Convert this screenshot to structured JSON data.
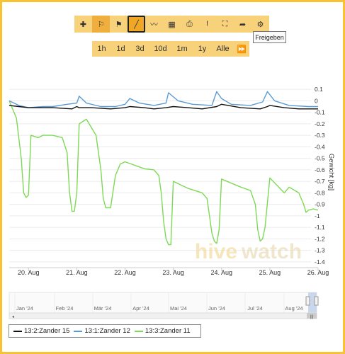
{
  "toolbar": {
    "buttons": [
      {
        "name": "add-icon",
        "glyph": "✚"
      },
      {
        "name": "flag-outline-icon",
        "glyph": "⚐"
      },
      {
        "name": "flag-icon",
        "glyph": "⚑"
      },
      {
        "name": "line-chart-icon",
        "glyph": "╱"
      },
      {
        "name": "annotate-chart-icon",
        "glyph": "〰"
      },
      {
        "name": "calendar-icon",
        "glyph": "▦"
      },
      {
        "name": "print-icon",
        "glyph": "⎙"
      },
      {
        "name": "alert-icon",
        "glyph": "!"
      },
      {
        "name": "fullscreen-icon",
        "glyph": "⛶"
      },
      {
        "name": "share-icon",
        "glyph": "➦"
      },
      {
        "name": "settings-icon",
        "glyph": "⚙"
      }
    ],
    "tooltip": "Freigeben"
  },
  "ranges": [
    "1h",
    "1d",
    "3d",
    "10d",
    "1m",
    "1y",
    "Alle"
  ],
  "ranges_forward_glyph": "⏩",
  "watermark": {
    "part1": "hive",
    "part2": "watch"
  },
  "colors": {
    "accent": "#f7c234",
    "series_black": "#111111",
    "series_blue": "#5b9bd5",
    "series_green": "#7ed957"
  },
  "chart_data": {
    "type": "line",
    "ylabel": "Gewicht [kg]",
    "ylim": [
      -1.45,
      0.15
    ],
    "yticks": [
      0.1,
      0,
      -0.1,
      -0.2,
      -0.3,
      -0.4,
      -0.5,
      -0.6,
      -0.7,
      -0.8,
      -0.9,
      -1,
      -1.1,
      -1.2,
      -1.3,
      -1.4
    ],
    "ytick_labels": [
      "0.1",
      "0",
      "-0.1",
      "-0.2",
      "-0.3",
      "-0.4",
      "-0.5",
      "-0.6",
      "-0.7",
      "-0.8",
      "-0.9",
      "-1",
      "-1.1",
      "-1.2",
      "-1.3",
      "-1.4"
    ],
    "xlim": [
      19.6,
      26.0
    ],
    "xticks": [
      20,
      21,
      22,
      23,
      24,
      25,
      26
    ],
    "xtick_labels": [
      "20. Aug",
      "21. Aug",
      "22. Aug",
      "23. Aug",
      "24. Aug",
      "25. Aug",
      "26. Aug"
    ],
    "series": [
      {
        "name": "13:2:Zander 15",
        "color": "#111111",
        "x": [
          19.6,
          19.8,
          20.0,
          20.5,
          20.9,
          21.0,
          21.05,
          21.3,
          21.7,
          22.0,
          22.1,
          22.4,
          22.6,
          22.85,
          23.0,
          23.3,
          23.6,
          23.9,
          24.0,
          24.4,
          24.8,
          24.95,
          25.0,
          25.3,
          25.6,
          26.0
        ],
        "y": [
          -0.04,
          -0.05,
          -0.06,
          -0.06,
          -0.07,
          -0.05,
          -0.06,
          -0.06,
          -0.07,
          -0.06,
          -0.05,
          -0.06,
          -0.07,
          -0.06,
          -0.05,
          -0.06,
          -0.07,
          -0.05,
          -0.03,
          -0.06,
          -0.07,
          -0.05,
          -0.04,
          -0.06,
          -0.07,
          -0.07
        ]
      },
      {
        "name": "13:1:Zander 12",
        "color": "#5b9bd5",
        "x": [
          19.6,
          19.8,
          20.0,
          20.3,
          20.5,
          20.8,
          21.0,
          21.05,
          21.2,
          21.5,
          21.8,
          22.0,
          22.1,
          22.3,
          22.6,
          22.85,
          22.9,
          23.1,
          23.4,
          23.8,
          23.9,
          24.0,
          24.2,
          24.6,
          24.85,
          24.95,
          25.1,
          25.4,
          25.8,
          26.0
        ],
        "y": [
          0.0,
          -0.04,
          -0.06,
          -0.05,
          -0.05,
          -0.03,
          -0.02,
          0.04,
          -0.02,
          -0.05,
          -0.05,
          -0.03,
          0.02,
          -0.02,
          -0.04,
          -0.02,
          0.07,
          0.0,
          -0.03,
          -0.04,
          0.08,
          0.02,
          -0.03,
          -0.04,
          -0.01,
          0.08,
          0.0,
          -0.04,
          -0.05,
          -0.05
        ]
      },
      {
        "name": "13:3:Zander 11",
        "color": "#7ed957",
        "x": [
          19.6,
          19.75,
          19.85,
          19.9,
          19.95,
          20.0,
          20.05,
          20.2,
          20.3,
          20.5,
          20.7,
          20.8,
          20.85,
          20.9,
          20.95,
          21.0,
          21.05,
          21.2,
          21.4,
          21.5,
          21.55,
          21.6,
          21.7,
          21.8,
          21.9,
          22.0,
          22.4,
          22.6,
          22.7,
          22.75,
          22.8,
          22.85,
          22.9,
          22.95,
          23.0,
          23.3,
          23.6,
          23.7,
          23.75,
          23.8,
          23.85,
          23.9,
          23.95,
          24.0,
          24.4,
          24.6,
          24.7,
          24.75,
          24.8,
          24.85,
          24.9,
          25.0,
          25.3,
          25.4,
          25.6,
          25.7,
          25.75,
          25.8,
          25.9,
          26.0
        ],
        "y": [
          0.0,
          -0.15,
          -0.5,
          -0.8,
          -0.84,
          -0.82,
          -0.3,
          -0.32,
          -0.3,
          -0.3,
          -0.32,
          -0.45,
          -0.8,
          -0.96,
          -0.96,
          -0.8,
          -0.2,
          -0.16,
          -0.3,
          -0.6,
          -0.85,
          -0.93,
          -0.93,
          -0.65,
          -0.55,
          -0.53,
          -0.59,
          -0.6,
          -0.65,
          -0.8,
          -1.05,
          -1.2,
          -1.25,
          -1.25,
          -0.7,
          -0.76,
          -0.8,
          -0.85,
          -1.0,
          -1.15,
          -1.22,
          -1.24,
          -1.12,
          -0.68,
          -0.75,
          -0.78,
          -0.9,
          -1.12,
          -1.22,
          -1.2,
          -1.1,
          -0.67,
          -0.8,
          -0.75,
          -0.8,
          -0.9,
          -0.97,
          -0.95,
          -0.94,
          -0.95
        ]
      }
    ],
    "navigator": {
      "labels": [
        "Jan '24",
        "Feb '24",
        "Mär '24",
        "Apr '24",
        "Mai '24",
        "Jun '24",
        "Jul '24",
        "Aug '24"
      ],
      "handle_glyph": "|||"
    },
    "legend_placement": "bottom-left"
  }
}
